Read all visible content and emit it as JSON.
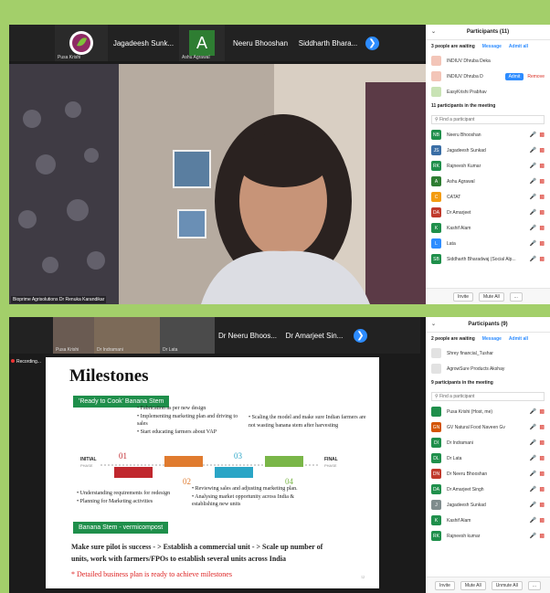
{
  "top": {
    "strip": {
      "tiles": [
        {
          "label": "Pusa Krishi"
        },
        {
          "label": "Jagadeesh  Sunk..."
        },
        {
          "label": "Ashu Agrawal",
          "initial": "A"
        },
        {
          "label": "Neeru Bhooshan"
        },
        {
          "label": "Siddharth  Bhara..."
        }
      ],
      "next_icon": "chevron-right-icon"
    },
    "video_label": "Bioprime Agrisolutions Dr Renuka Karandikar",
    "participants": {
      "title": "Participants (11)",
      "waiting_text": "3 people are waiting",
      "message_label": "Message",
      "admit_all_label": "Admit all",
      "waiting": [
        {
          "name": "INDIUV Dhruba Deka"
        },
        {
          "name": "INDIUV Dhruba D",
          "admit": "Admit",
          "remove": "Remove"
        },
        {
          "name": "EasyKrishi Prabhav"
        }
      ],
      "in_meeting_text": "11 participants in the meeting",
      "find_placeholder": "Find a participant",
      "list": [
        {
          "initials": "NB",
          "name": "Neeru Bhooshan",
          "color": "#1f8f4b"
        },
        {
          "initials": "JS",
          "name": "Jagadeesh Sunkad",
          "color": "#3a6ea5"
        },
        {
          "initials": "RK",
          "name": "Rajneesh Kumar",
          "color": "#1f8f4b"
        },
        {
          "initials": "A",
          "name": "Ashu Agrawal",
          "color": "#2e7d32"
        },
        {
          "initials": "C",
          "name": "CATAT",
          "color": "#f39c12"
        },
        {
          "initials": "DA",
          "name": "Dr Amarjeet",
          "color": "#c0392b"
        },
        {
          "initials": "K",
          "name": "Kashif Alam",
          "color": "#1f8f4b"
        },
        {
          "initials": "L",
          "name": "Lata",
          "color": "#2d8cff"
        },
        {
          "initials": "SB",
          "name": "Siddharth Bharadwaj (Social Alp...",
          "color": "#1f8f4b"
        }
      ],
      "footer": {
        "invite": "Invite",
        "mute_all": "Mute All",
        "more": "..."
      }
    }
  },
  "bottom": {
    "strip": {
      "tiles": [
        {
          "label": "Pusa Krishi"
        },
        {
          "label": "Dr Indramani"
        },
        {
          "label": "Dr Lata"
        },
        {
          "label": "Dr Neeru Bhoos..."
        },
        {
          "label": "Dr Amarjeet Sin..."
        }
      ]
    },
    "recording_label": "Recording...",
    "slide": {
      "title": "Milestones",
      "badge1": "'Ready to Cook' Banana Stem",
      "top_bullets_a": [
        "Fabrication as per new design",
        "Implementing marketing plan and driving to sales",
        "Start educating farmers about VAP"
      ],
      "top_bullets_b": [
        "Scaling the model and make sure Indian farmers are not wasting banana stem after harvesting"
      ],
      "initial_label": "INITIAL",
      "initial_sub": "PHASE",
      "final_label": "FINAL",
      "final_sub": "PHASE",
      "steps": [
        "01",
        "02",
        "03",
        "04"
      ],
      "bottom_bullets_a": [
        "Understanding requirements for redesign",
        "Planning for Marketing activities"
      ],
      "bottom_bullets_b": [
        "Reviewing sales and adjusting marketing plan.",
        "Analysing market opportunity across India & establishing new units"
      ],
      "badge2": "Banana Stem - vermicompost",
      "pilot_line1": "Make sure pilot is success - > Establish a commercial unit - > Scale up number of",
      "pilot_line2": "units, work with farmers/FPOs to establish several units across India",
      "plan_line": "* Detailed business plan is ready to achieve milestones",
      "page_number": "12"
    },
    "participants": {
      "title": "Participants (9)",
      "waiting_text": "2 people are waiting",
      "message_label": "Message",
      "admit_all_label": "Admit all",
      "waiting": [
        {
          "name": "Shrey financial_Tushar"
        },
        {
          "name": "AgrowSure Products Akshay"
        }
      ],
      "in_meeting_text": "9 participants in the meeting",
      "find_placeholder": "Find a participant",
      "list": [
        {
          "initials": "",
          "name": "Pusa Krishi (Host, me)",
          "color": "#1f8f4b"
        },
        {
          "initials": "GN",
          "name": "GV Natural Food Naveen Gv",
          "color": "#d35400"
        },
        {
          "initials": "DI",
          "name": "Dr Indramani",
          "color": "#1f8f4b"
        },
        {
          "initials": "DL",
          "name": "Dr Lata",
          "color": "#1f8f4b"
        },
        {
          "initials": "DN",
          "name": "Dr Neeru Bhooshan",
          "color": "#c0392b"
        },
        {
          "initials": "DA",
          "name": "Dr Amarjeet Singh",
          "color": "#1f8f4b"
        },
        {
          "initials": "J",
          "name": "Jagadeesh Sunkad",
          "color": "#7f8c8d"
        },
        {
          "initials": "K",
          "name": "Kashif Alam",
          "color": "#1f8f4b"
        },
        {
          "initials": "RK",
          "name": "Rajneesh kumar",
          "color": "#1f8f4b"
        }
      ],
      "footer": {
        "invite": "Invite",
        "mute_all": "Mute All",
        "unmute_all": "Unmute All",
        "more": "..."
      }
    }
  }
}
